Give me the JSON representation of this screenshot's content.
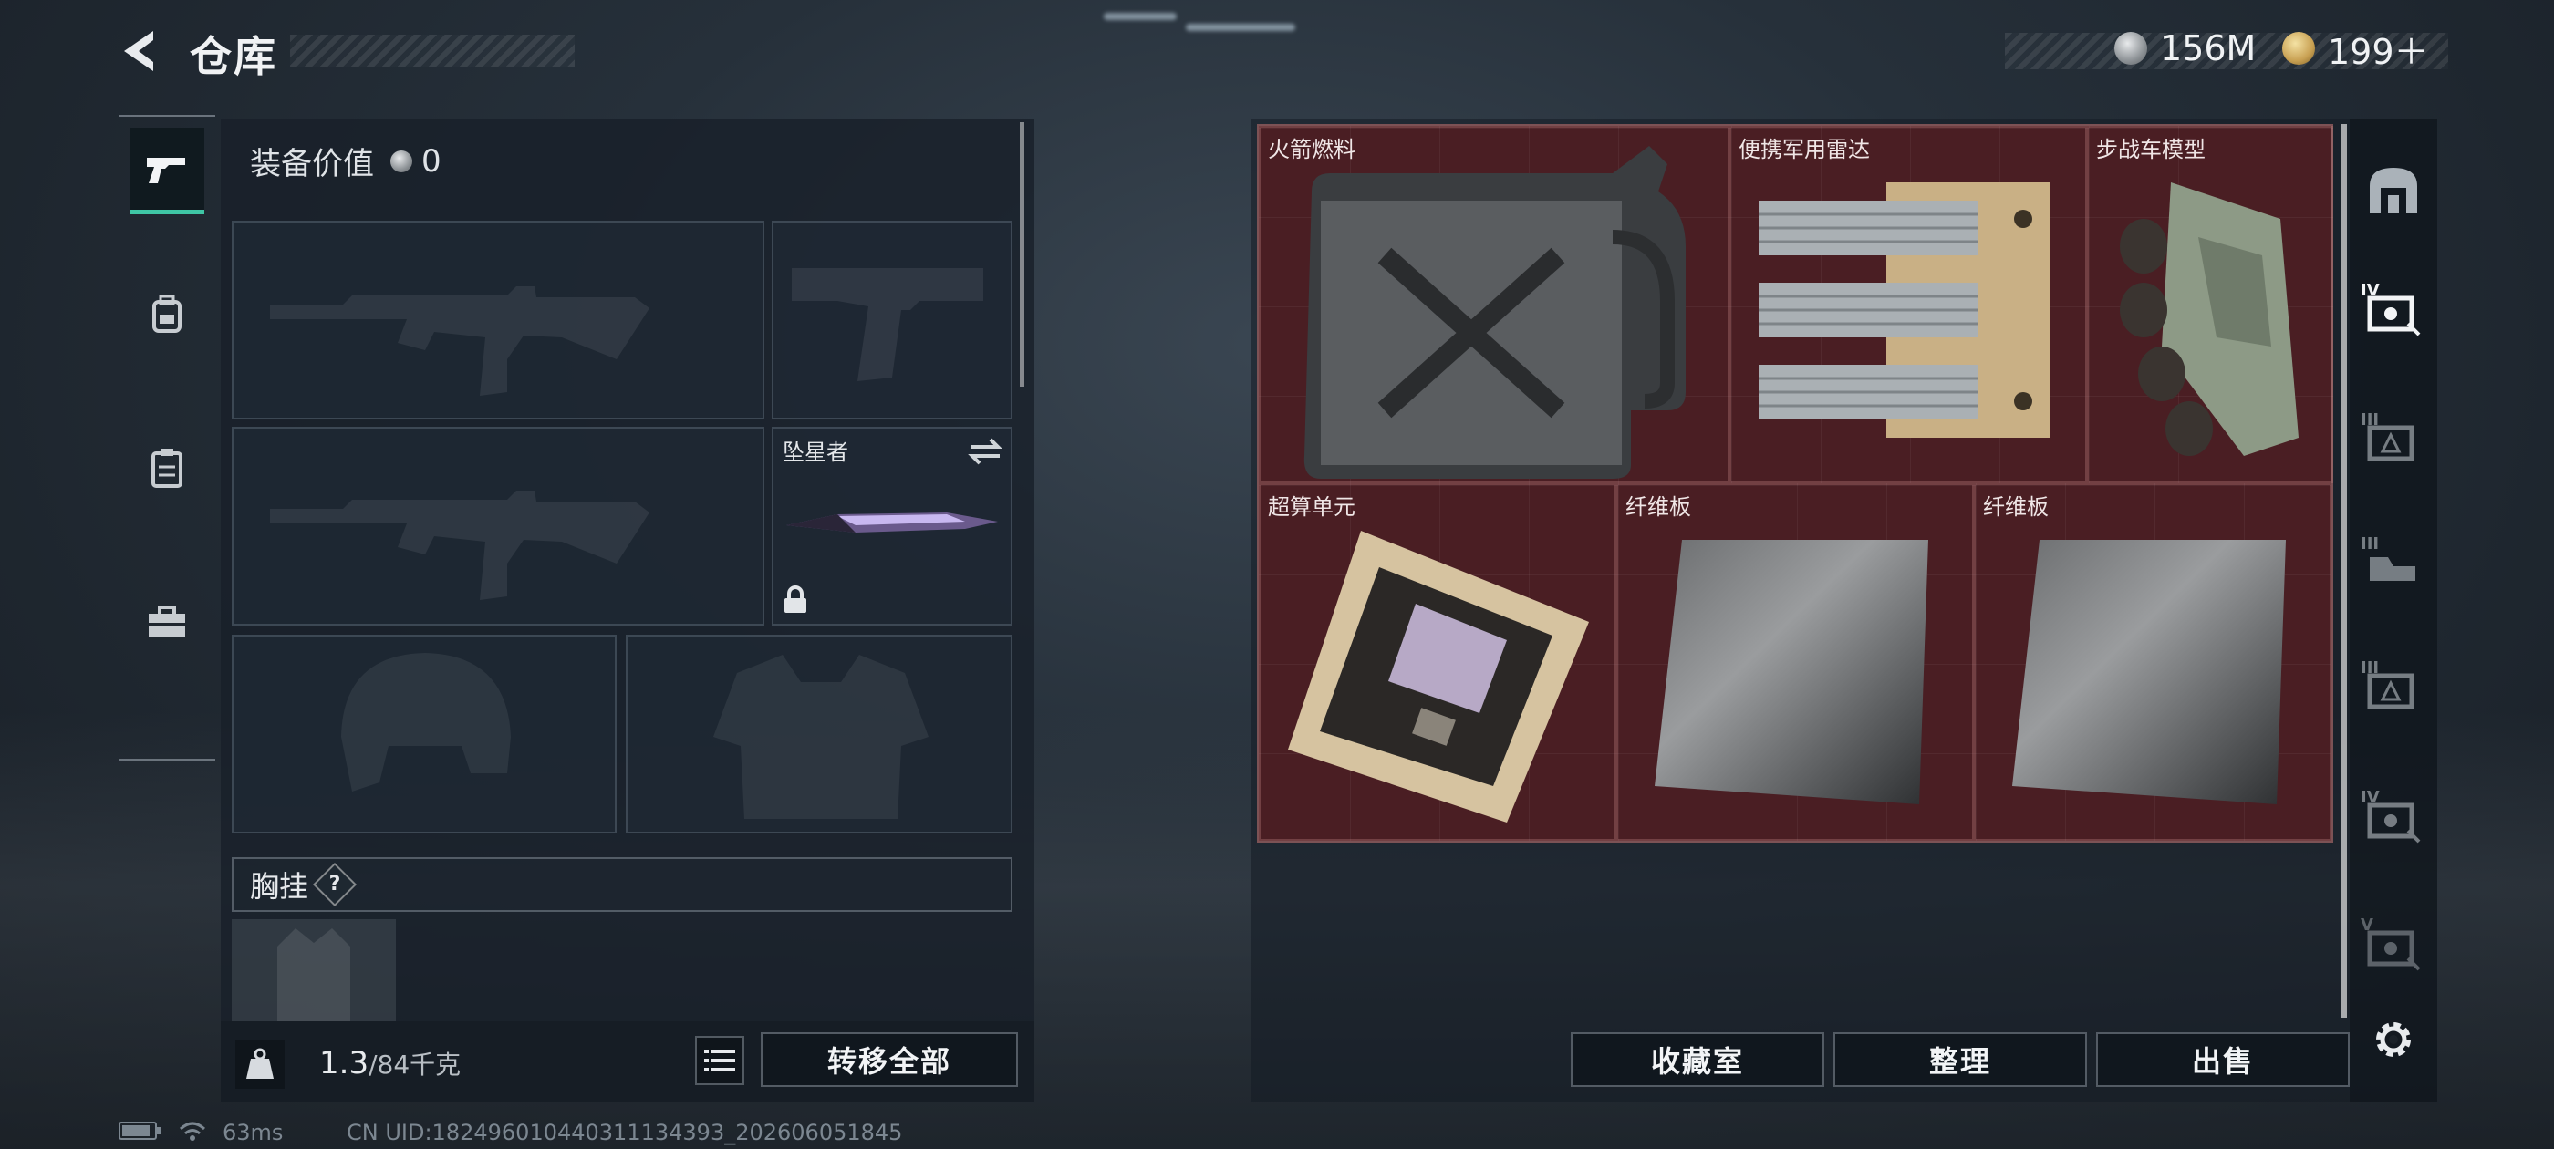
{
  "header": {
    "title": "仓库",
    "currencies": [
      {
        "icon": "silver-coin-icon",
        "amount": "156M"
      },
      {
        "icon": "gold-coin-icon",
        "amount": "199＋"
      }
    ]
  },
  "left_sidebar": {
    "tabs": [
      {
        "icon": "pistol-icon",
        "active": true
      },
      {
        "icon": "backpack-icon",
        "active": false
      },
      {
        "icon": "clipboard-icon",
        "active": false
      },
      {
        "icon": "toolbox-icon",
        "active": false
      }
    ]
  },
  "equipment": {
    "value_label": "装备价值",
    "value_amount": "0",
    "melee_slot_label": "坠星者",
    "chest_rig_label": "胸挂",
    "chest_rig_help": "?",
    "weight_current": "1.3",
    "weight_capacity": "/84千克",
    "transfer_all_label": "转移全部"
  },
  "storage": {
    "items": [
      {
        "name": "火箭燃料",
        "icon": "jerrycan-icon"
      },
      {
        "name": "便携军用雷达",
        "icon": "radar-icon"
      },
      {
        "name": "步战车模型",
        "icon": "ifv-model-icon"
      },
      {
        "name": "超算单元",
        "icon": "circuit-board-icon"
      },
      {
        "name": "纤维板",
        "icon": "fiber-board-icon"
      },
      {
        "name": "纤维板",
        "icon": "fiber-board-icon"
      }
    ],
    "buttons": {
      "collection": "收藏室",
      "sort": "整理",
      "sell": "出售"
    }
  },
  "right_sidebar": {
    "tabs": [
      {
        "icon": "arch-icon",
        "tier": ""
      },
      {
        "icon": "safe-icon",
        "tier": "IV"
      },
      {
        "icon": "safe-icon",
        "tier": "III"
      },
      {
        "icon": "safe-icon",
        "tier": "III"
      },
      {
        "icon": "safe-icon",
        "tier": "III"
      },
      {
        "icon": "safe-icon",
        "tier": "IV"
      },
      {
        "icon": "safe-icon",
        "tier": "V"
      }
    ],
    "settings_icon": "gear-icon"
  },
  "status_bar": {
    "ping": "63ms",
    "uid": "CN UID:18249601044031113439​3_202606051845"
  },
  "colors": {
    "accent": "#3fc6a5",
    "storage_bg": "#4a1e23"
  }
}
